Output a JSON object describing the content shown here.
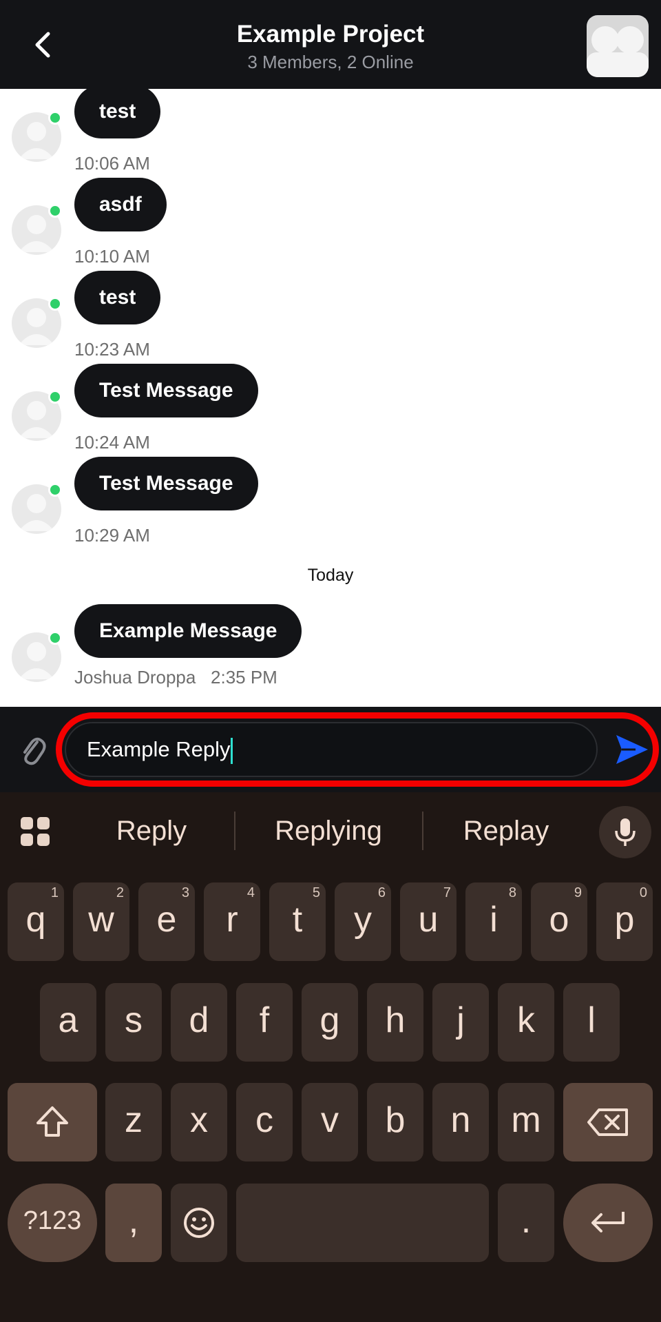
{
  "header": {
    "title": "Example Project",
    "subtitle": "3 Members, 2 Online",
    "back_icon": "chevron-left-icon",
    "group_avatar_icon": "group-avatar-icon"
  },
  "messages": [
    {
      "text": "test",
      "time": "10:06 AM"
    },
    {
      "text": "asdf",
      "time": "10:10 AM"
    },
    {
      "text": "test",
      "time": "10:23 AM"
    },
    {
      "text": "Test Message",
      "time": "10:24 AM"
    },
    {
      "text": "Test Message",
      "time": "10:29 AM"
    }
  ],
  "day_separator": "Today",
  "today_message": {
    "text": "Example Message",
    "sender": "Joshua Droppa",
    "time": "2:35 PM"
  },
  "composer": {
    "value": "Example Reply",
    "attach_icon": "paperclip-icon",
    "send_icon": "send-icon",
    "highlight_color": "#f40000"
  },
  "keyboard": {
    "suggestions": [
      "Reply",
      "Replying",
      "Replay"
    ],
    "row1": [
      {
        "k": "q",
        "n": "1"
      },
      {
        "k": "w",
        "n": "2"
      },
      {
        "k": "e",
        "n": "3"
      },
      {
        "k": "r",
        "n": "4"
      },
      {
        "k": "t",
        "n": "5"
      },
      {
        "k": "y",
        "n": "6"
      },
      {
        "k": "u",
        "n": "7"
      },
      {
        "k": "i",
        "n": "8"
      },
      {
        "k": "o",
        "n": "9"
      },
      {
        "k": "p",
        "n": "0"
      }
    ],
    "row2": [
      "a",
      "s",
      "d",
      "f",
      "g",
      "h",
      "j",
      "k",
      "l"
    ],
    "row3": [
      "z",
      "x",
      "c",
      "v",
      "b",
      "n",
      "m"
    ],
    "symbols_label": "?123",
    "comma": ",",
    "period": "."
  },
  "colors": {
    "header_bg": "#131417",
    "bubble_bg": "#131417",
    "online": "#2fd06a",
    "send_blue": "#1a5cff",
    "keyboard_bg": "#1f1714"
  }
}
